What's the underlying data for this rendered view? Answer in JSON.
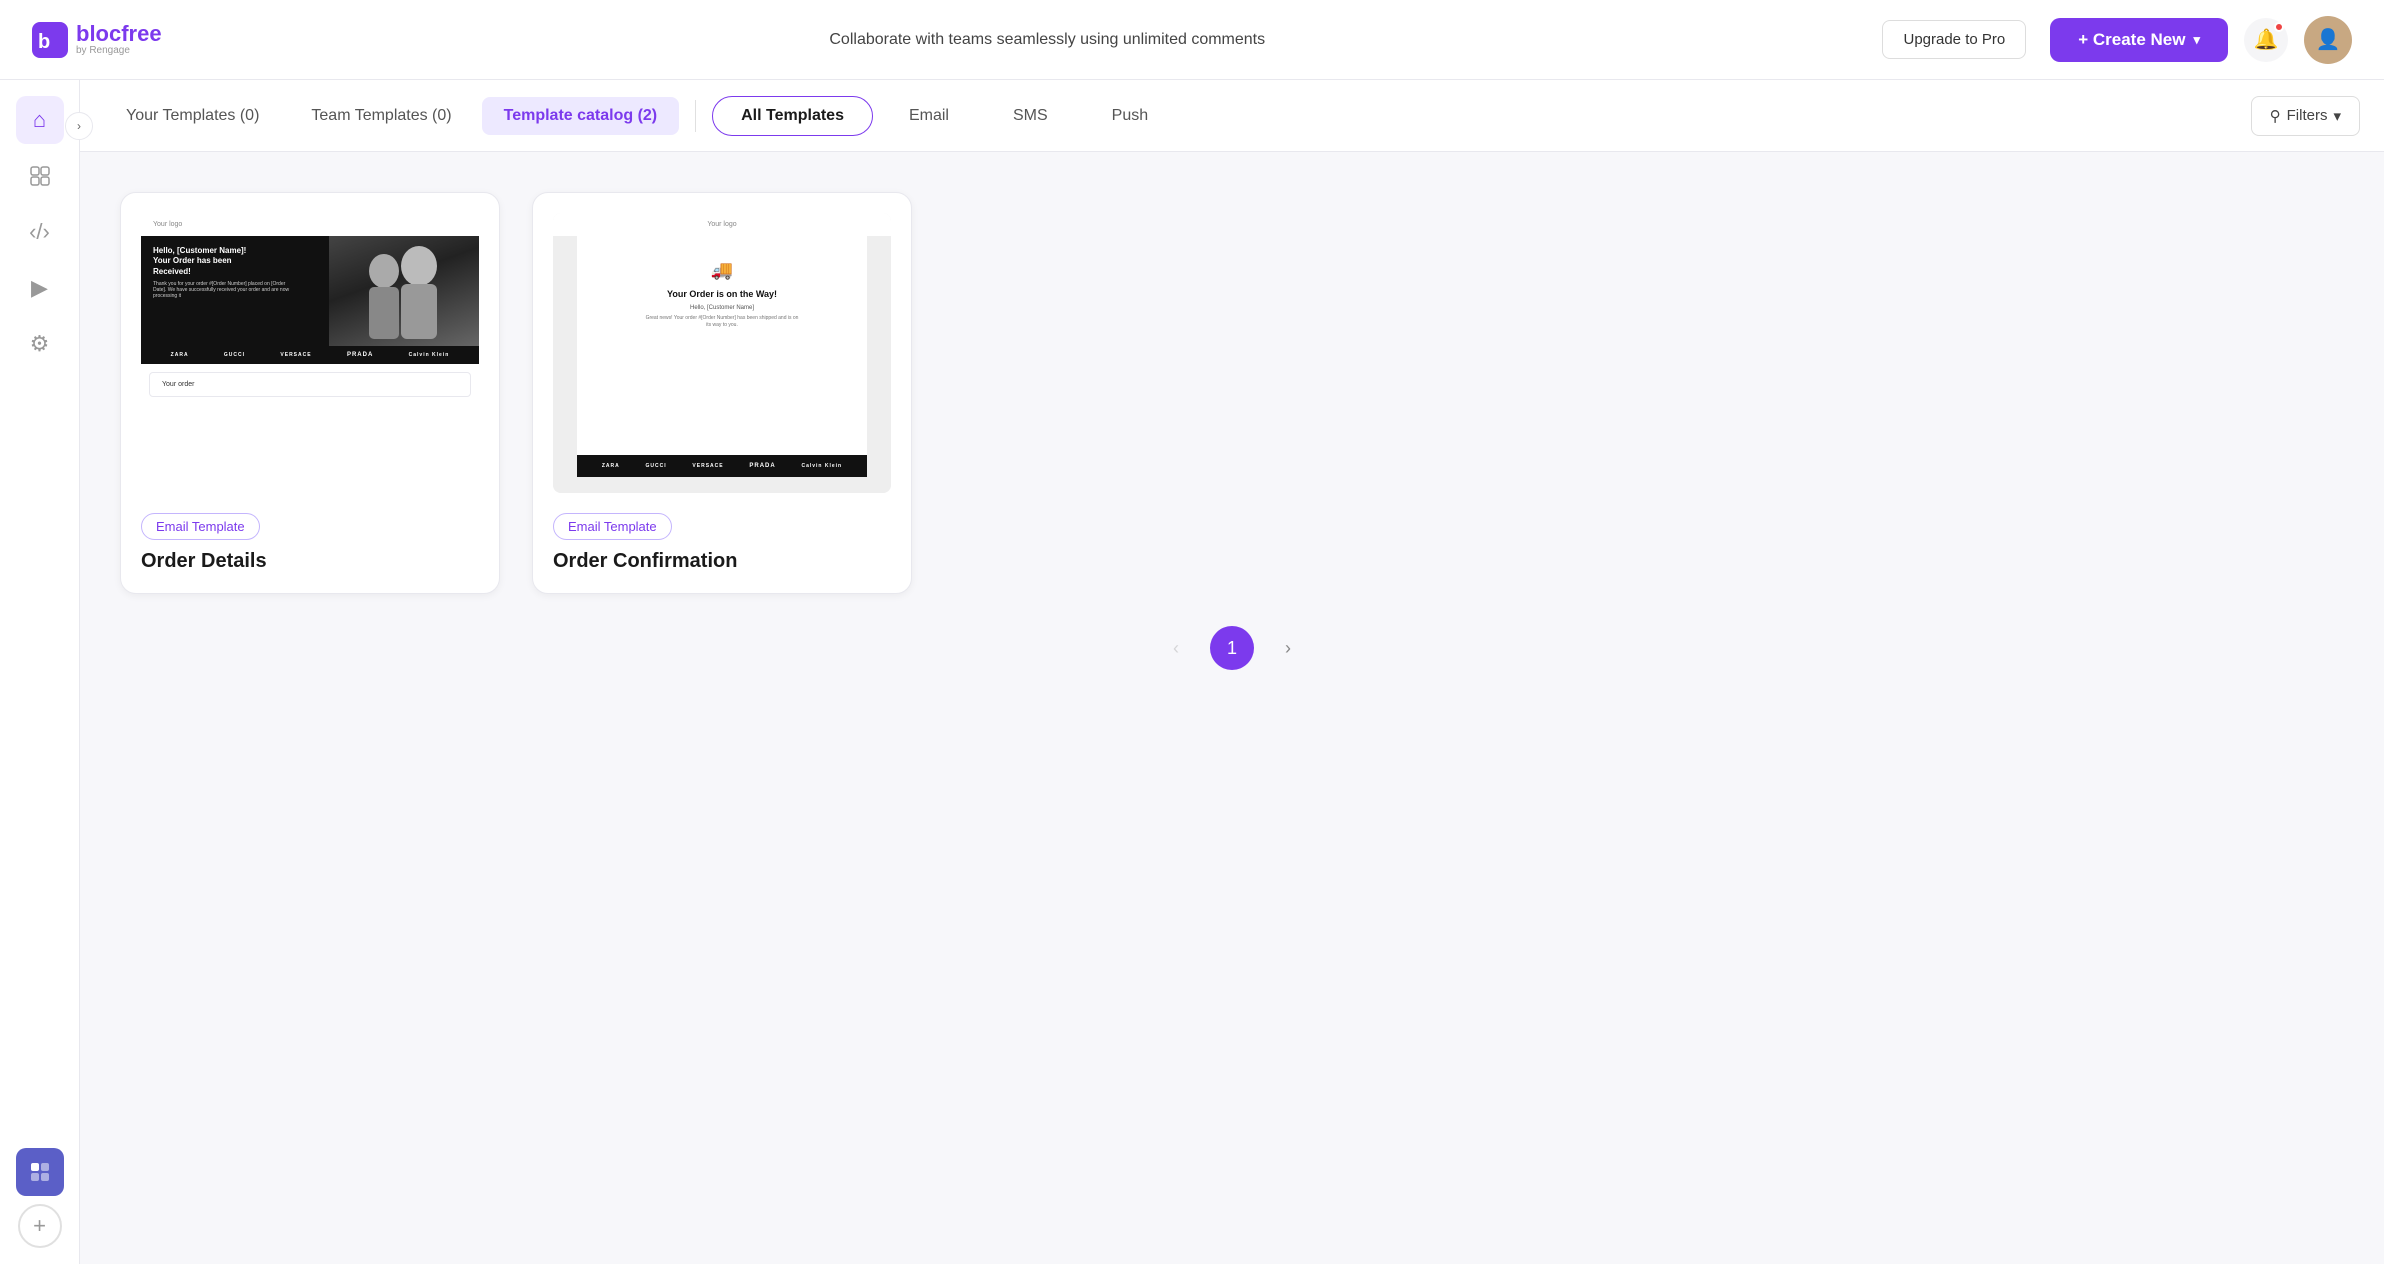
{
  "header": {
    "logo_text": "blocfree",
    "logo_sub": "by Rengage",
    "promo_text": "Collaborate with teams seamlessly using unlimited comments",
    "upgrade_label": "Upgrade to Pro",
    "create_new_label": "+ Create New"
  },
  "tabs": {
    "your_templates": "Your Templates (0)",
    "team_templates": "Team Templates (0)",
    "template_catalog": "Template catalog (2)",
    "all_templates": "All Templates",
    "email": "Email",
    "sms": "SMS",
    "push": "Push",
    "filters": "Filters"
  },
  "templates": [
    {
      "tag": "Email Template",
      "title": "Order Details",
      "preview_header": "Your logo",
      "preview_hero_line1": "Hello, [Customer Name]!",
      "preview_hero_line2": "Your Order has been Received!",
      "preview_body": "Thank you for your order #[Order Number] placed on [Order Date]. We have successfully received your order and are now processing it.",
      "brands": [
        "ZARA",
        "GUCCI",
        "VERSACE",
        "PRADA",
        "Calvin Klein"
      ],
      "order_label": "Your order"
    },
    {
      "tag": "Email Template",
      "title": "Order Confirmation",
      "preview_logo": "Your logo",
      "preview_title": "Your Order is on the Way!",
      "preview_name": "Hello, [Customer Name]",
      "preview_body": "Great news! Your order #[Order Number] has been shipped and is on its way to you.",
      "brands": [
        "ZARA",
        "GUCCI",
        "VERSACE",
        "PRADA",
        "Calvin Klein"
      ]
    }
  ],
  "pagination": {
    "current": "1"
  }
}
